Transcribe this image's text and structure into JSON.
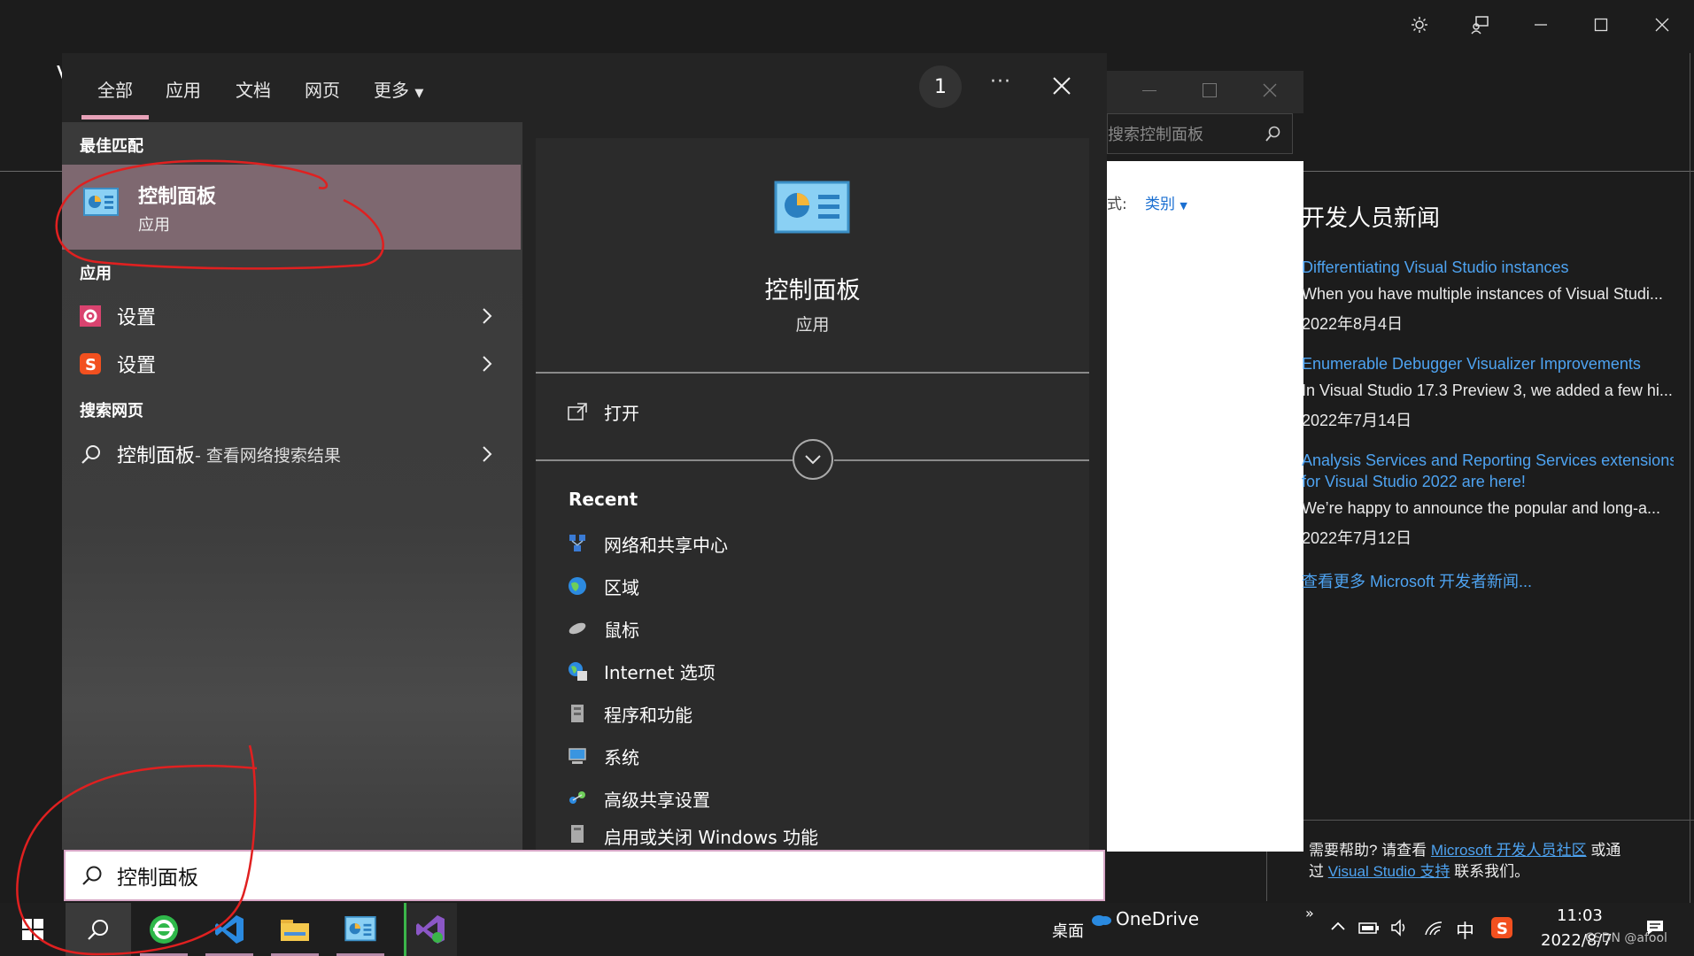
{
  "vs_window": {
    "buttons": [
      "sun-icon",
      "feedback-icon",
      "minimize-icon",
      "maximize-icon",
      "close-icon"
    ],
    "cut_letter": "V"
  },
  "control_panel_window": {
    "search_placeholder": "搜索控制面板",
    "view_prefix": "式:",
    "view_value": "类别"
  },
  "dev_news": {
    "heading": "开发人员新闻",
    "items": [
      {
        "title": "Differentiating Visual Studio instances",
        "title2": "",
        "summary": "When you have multiple instances of Visual Studi...",
        "date": "2022年8月4日"
      },
      {
        "title": "Enumerable Debugger Visualizer Improvements",
        "title2": "",
        "summary": "In Visual Studio 17.3 Preview 3, we added a few hi...",
        "date": "2022年7月14日"
      },
      {
        "title": "Analysis Services and Reporting Services extensions",
        "title2": "for Visual Studio 2022 are here!",
        "summary": "We’re happy to announce the popular and long-a...",
        "date": "2022年7月12日"
      }
    ],
    "more_link": "查看更多 Microsoft 开发者新闻...",
    "help_prefix": "需要帮助? 请查看 ",
    "help_link1": "Microsoft 开发人员社区",
    "help_mid": " 或通",
    "help_prefix2": "过 ",
    "help_link2": "Visual Studio 支持",
    "help_suffix": " 联系我们。"
  },
  "start_menu": {
    "tabs": [
      "全部",
      "应用",
      "文档",
      "网页",
      "更多"
    ],
    "active_tab": "全部",
    "badge": "1",
    "more_options": "···",
    "best_match_heading": "最佳匹配",
    "best_match": {
      "title": "控制面板",
      "subtitle": "应用"
    },
    "apps_heading": "应用",
    "apps": [
      {
        "label": "设置"
      },
      {
        "label": "设置"
      }
    ],
    "web_heading": "搜索网页",
    "web_result": {
      "query": "控制面板",
      "suffix": " - 查看网络搜索结果"
    },
    "detail": {
      "title": "控制面板",
      "subtitle": "应用",
      "open_label": "打开",
      "recent_heading": "Recent",
      "recent": [
        "网络和共享中心",
        "区域",
        "鼠标",
        "Internet 选项",
        "程序和功能",
        "系统",
        "高级共享设置",
        "启用或关闭 Windows 功能"
      ]
    },
    "search_value": "控制面板"
  },
  "taskbar": {
    "desktop_label": "桌面",
    "onedrive_label": "OneDrive",
    "ime_label": "中",
    "time": "11:03",
    "date": "2022/8/7",
    "watermark": "CSDN @afool"
  },
  "colors": {
    "accent_tab_underline": "#e7a1b8",
    "link": "#4ea3f1",
    "best_match_bg": "#7e6870",
    "annotation": "#e02020"
  }
}
